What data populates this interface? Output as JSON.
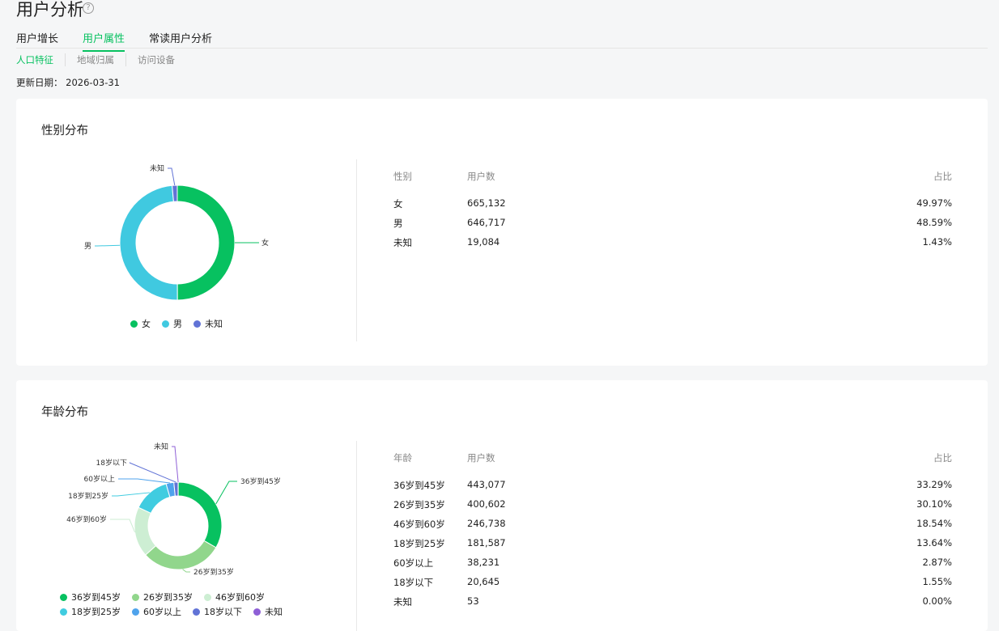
{
  "header": {
    "title": "用户分析",
    "help_icon": "?"
  },
  "tabs": [
    {
      "label": "用户增长"
    },
    {
      "label": "用户属性",
      "active": true
    },
    {
      "label": "常读用户分析"
    }
  ],
  "subtabs": [
    {
      "label": "人口特征",
      "active": true
    },
    {
      "label": "地域归属"
    },
    {
      "label": "访问设备"
    }
  ],
  "update": {
    "label": "更新日期：",
    "value": "2026-03-31"
  },
  "gender": {
    "title": "性别分布",
    "headers": [
      "性别",
      "用户数",
      "占比"
    ],
    "rows": [
      {
        "name": "女",
        "count": "665,132",
        "pct": "49.97%",
        "value": 665132,
        "color": "#07c160"
      },
      {
        "name": "男",
        "count": "646,717",
        "pct": "48.59%",
        "value": 646717,
        "color": "#40c9e0"
      },
      {
        "name": "未知",
        "count": "19,084",
        "pct": "1.43%",
        "value": 19084,
        "color": "#6173d6"
      }
    ]
  },
  "age": {
    "title": "年龄分布",
    "headers": [
      "年龄",
      "用户数",
      "占比"
    ],
    "rows": [
      {
        "name": "36岁到45岁",
        "count": "443,077",
        "pct": "33.29%",
        "value": 443077,
        "color": "#07c160"
      },
      {
        "name": "26岁到35岁",
        "count": "400,602",
        "pct": "30.10%",
        "value": 400602,
        "color": "#91d68c"
      },
      {
        "name": "46岁到60岁",
        "count": "246,738",
        "pct": "18.54%",
        "value": 246738,
        "color": "#cdeed3"
      },
      {
        "name": "18岁到25岁",
        "count": "181,587",
        "pct": "13.64%",
        "value": 181587,
        "color": "#40cce0"
      },
      {
        "name": "60岁以上",
        "count": "38,231",
        "pct": "2.87%",
        "value": 38231,
        "color": "#4fa3ec"
      },
      {
        "name": "18岁以下",
        "count": "20,645",
        "pct": "1.55%",
        "value": 20645,
        "color": "#6173d6"
      },
      {
        "name": "未知",
        "count": "53",
        "pct": "0.00%",
        "value": 53,
        "color": "#8e5fd6"
      }
    ]
  }
}
